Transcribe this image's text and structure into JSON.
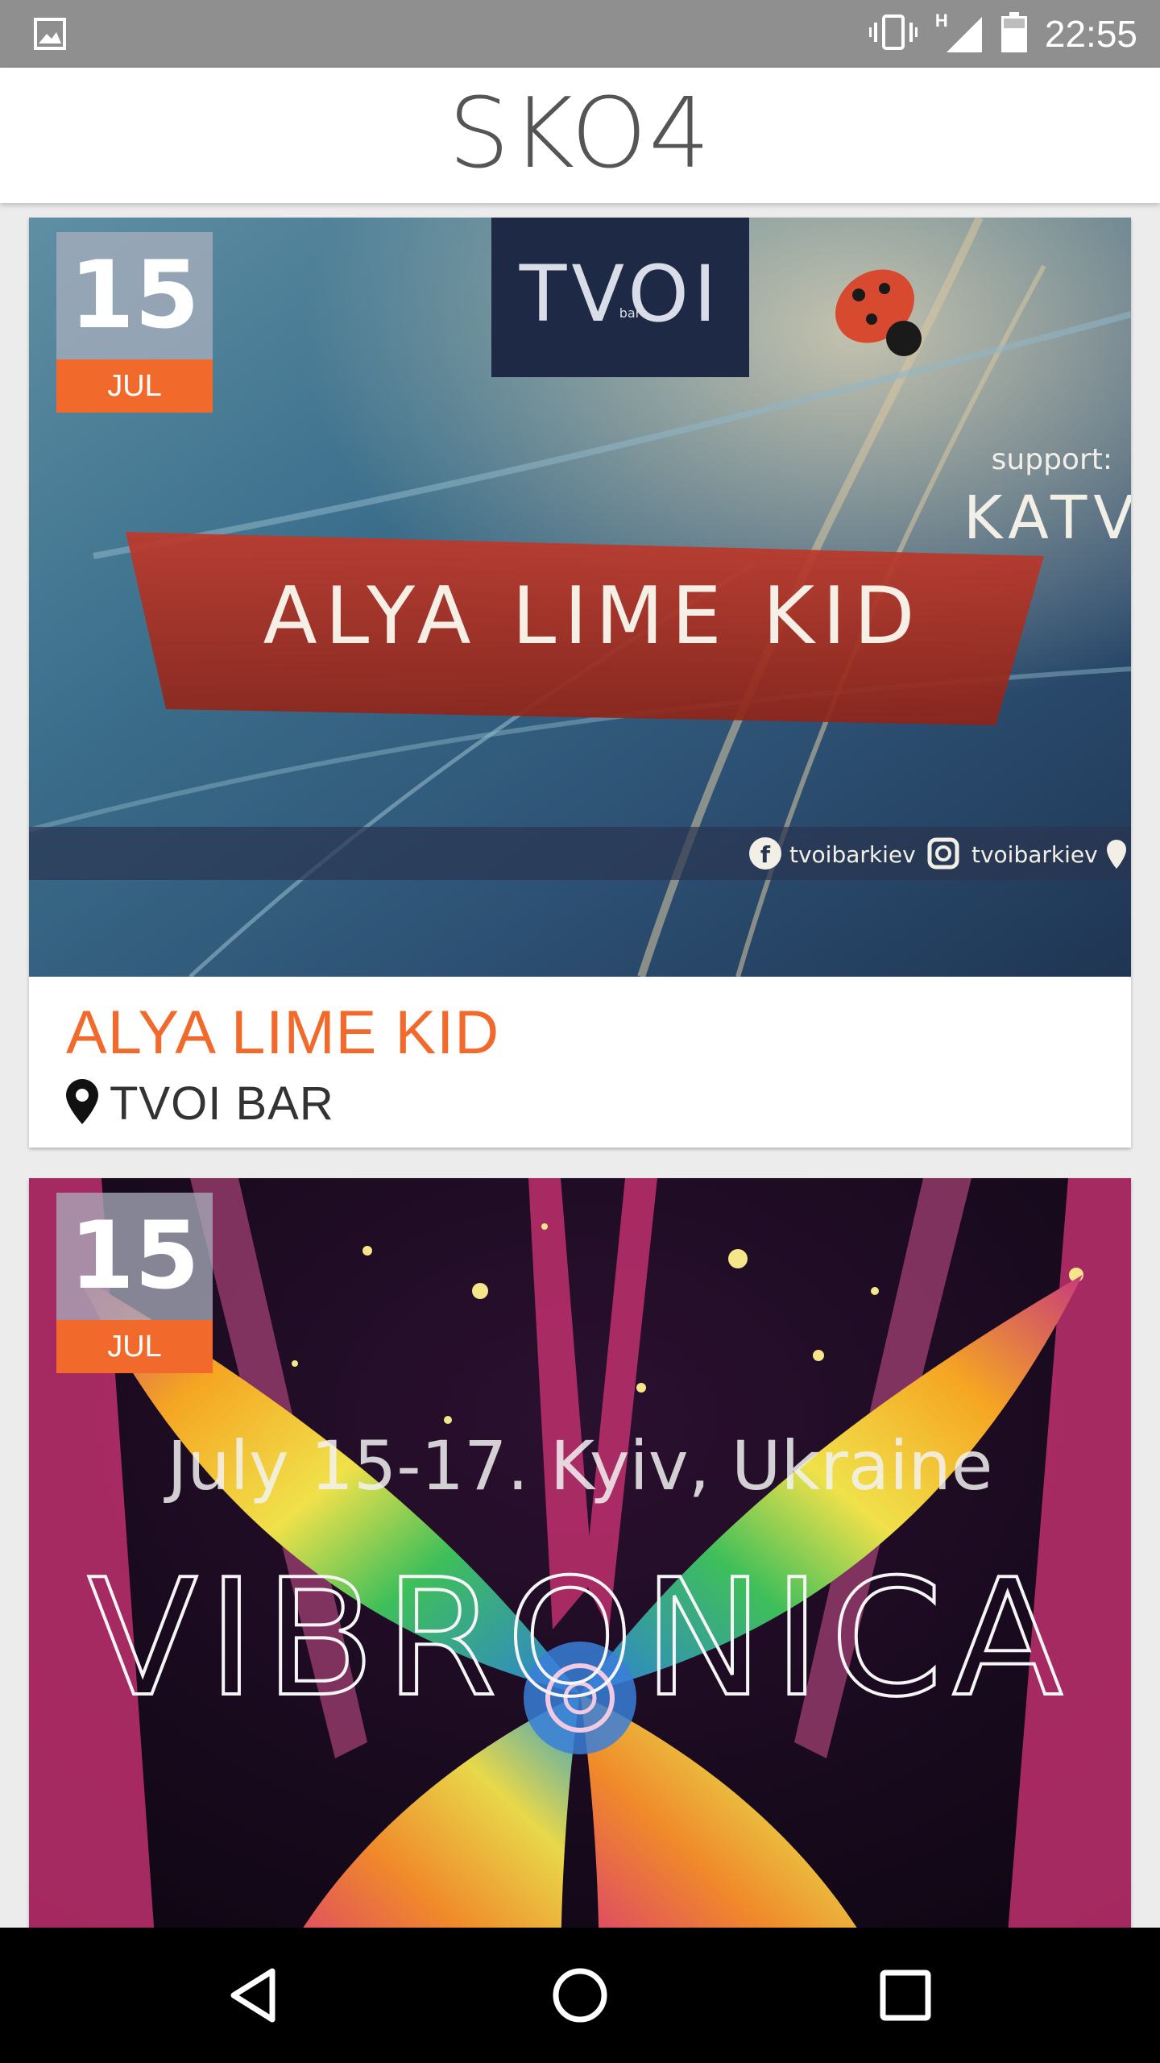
{
  "status_bar": {
    "network_label": "H",
    "time": "22:55"
  },
  "header": {
    "logo": "SKO4"
  },
  "events": [
    {
      "day": "15",
      "month": "JUL",
      "title": "ALYA LIME KID",
      "venue": "TVOI BAR",
      "poster": {
        "venue_logo": "TVOI",
        "venue_logo_sub": "bar",
        "support_label": "support:",
        "support_name": "KATV",
        "headline": "ALYA LIME KID",
        "facebook_handle": "tvoibarkiev",
        "instagram_handle": "tvoibarkiev"
      }
    },
    {
      "day": "15",
      "month": "JUL",
      "poster": {
        "dates_line": "July 15-17. Kyiv, Ukraine",
        "headline": "VIBRONICA"
      }
    }
  ],
  "colors": {
    "accent": "#f26a2b",
    "status_bar": "#8f8f8f",
    "nav_bar": "#000000"
  },
  "icons": {
    "status": [
      "image-notification-icon",
      "vibrate-icon",
      "signal-icon",
      "battery-icon"
    ],
    "nav": [
      "back-icon",
      "home-icon",
      "recents-icon"
    ],
    "venue": "location-pin-icon"
  }
}
